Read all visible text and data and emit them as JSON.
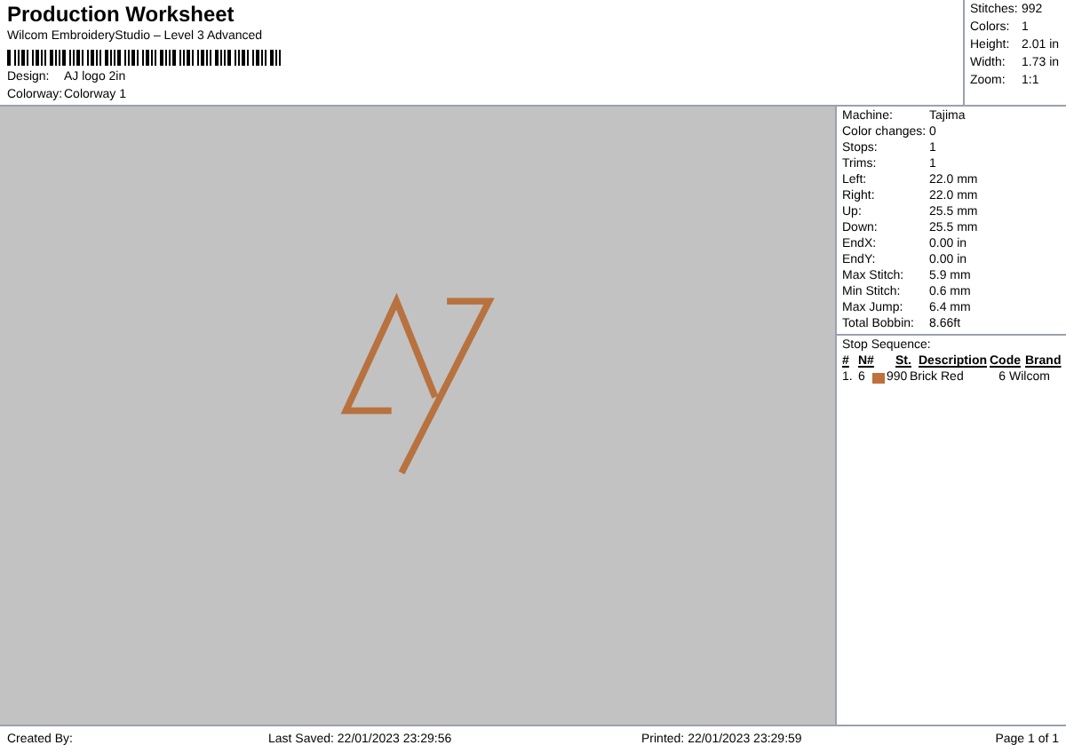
{
  "header": {
    "title": "Production Worksheet",
    "subtitle": "Wilcom EmbroideryStudio – Level 3 Advanced",
    "fields": [
      {
        "label": "Design:",
        "value": "AJ logo 2in"
      },
      {
        "label": "Colorway:",
        "value": "Colorway 1"
      }
    ]
  },
  "summary": [
    {
      "label": "Stitches:",
      "value": "992"
    },
    {
      "label": "Colors:",
      "value": "1"
    },
    {
      "label": "Height:",
      "value": "2.01 in"
    },
    {
      "label": "Width:",
      "value": "1.73 in"
    },
    {
      "label": "Zoom:",
      "value": "1:1"
    }
  ],
  "details": [
    {
      "label": "Machine:",
      "value": "Tajima"
    },
    {
      "label": "Color changes:",
      "value": "0"
    },
    {
      "label": "Stops:",
      "value": "1"
    },
    {
      "label": "Trims:",
      "value": "1"
    },
    {
      "label": "Left:",
      "value": "22.0 mm"
    },
    {
      "label": "Right:",
      "value": "22.0 mm"
    },
    {
      "label": "Up:",
      "value": "25.5 mm"
    },
    {
      "label": "Down:",
      "value": "25.5 mm"
    },
    {
      "label": "EndX:",
      "value": "0.00 in"
    },
    {
      "label": "EndY:",
      "value": "0.00 in"
    },
    {
      "label": "Max Stitch:",
      "value": "5.9 mm"
    },
    {
      "label": "Min Stitch:",
      "value": "0.6 mm"
    },
    {
      "label": "Max Jump:",
      "value": "6.4 mm"
    },
    {
      "label": "Total Bobbin:",
      "value": "8.66ft"
    }
  ],
  "stop_sequence": {
    "title": "Stop Sequence:",
    "columns": [
      "#",
      "N#",
      "St.",
      "Description",
      "Code",
      "Brand"
    ],
    "rows": [
      {
        "index": "1.",
        "needle": "6",
        "color": "#c0703a",
        "stitches": "990",
        "description": "Brick Red",
        "code": "6",
        "brand": "Wilcom"
      }
    ]
  },
  "footer": {
    "created_by": "Created By:",
    "last_saved": "Last Saved: 22/01/2023 23:29:56",
    "printed": "Printed: 22/01/2023 23:29:59",
    "page": "Page 1 of 1"
  }
}
